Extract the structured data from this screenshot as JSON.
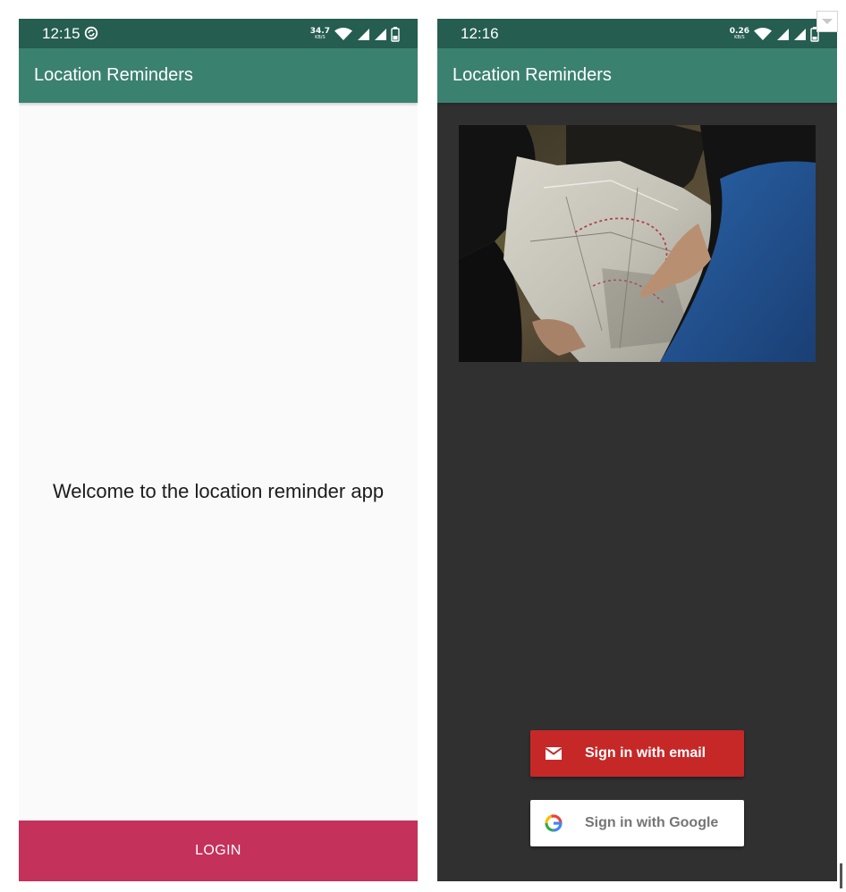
{
  "left_screen": {
    "status_bar": {
      "time": "12:15",
      "net_speed_value": "34.7",
      "net_speed_unit": "KB/S"
    },
    "app_bar": {
      "title": "Location Reminders"
    },
    "welcome_text": "Welcome to the location reminder app",
    "login_button_label": "LOGIN"
  },
  "right_screen": {
    "status_bar": {
      "time": "12:16",
      "net_speed_value": "0.26",
      "net_speed_unit": "KB/S"
    },
    "app_bar": {
      "title": "Location Reminders"
    },
    "email_button_label": "Sign in with email",
    "google_button_label": "Sign in with Google"
  },
  "icons": {
    "status_left": [
      "sync-icon",
      "wifi-icon",
      "signal-icon",
      "signal-icon",
      "battery-icon"
    ],
    "status_right": [
      "wifi-icon",
      "signal-icon",
      "signal-icon",
      "battery-icon"
    ],
    "email_button": "mail-icon",
    "google_button": "google-logo-icon"
  },
  "colors": {
    "status_bar": "#255d50",
    "app_bar": "#3b8170",
    "login_button": "#c4315b",
    "email_button": "#c62828",
    "dark_background": "#303030",
    "light_background": "#fafafa"
  }
}
